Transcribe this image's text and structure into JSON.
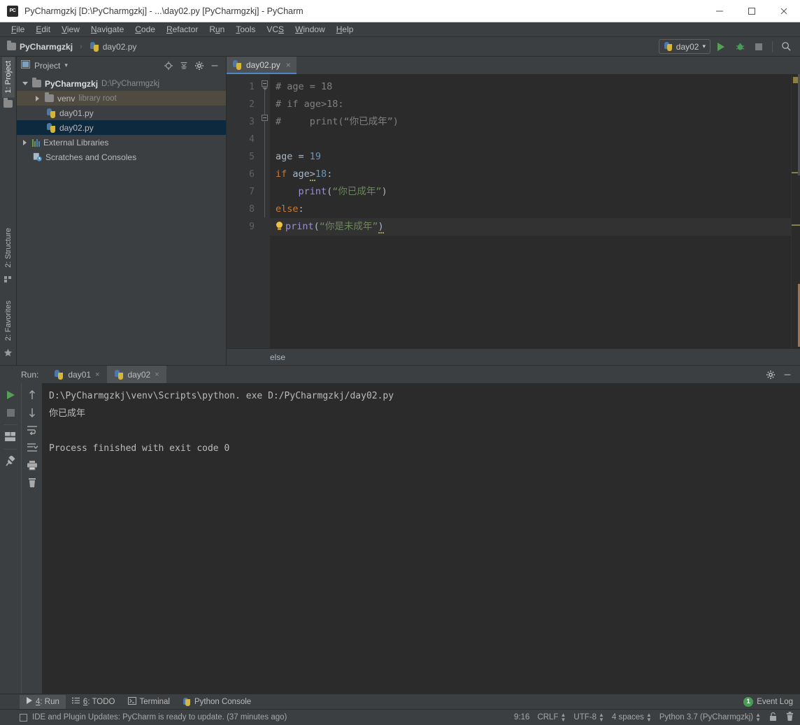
{
  "window": {
    "title": "PyCharmgzkj [D:\\PyCharmgzkj] - ...\\day02.py [PyCharmgzkj] - PyCharm",
    "app_badge": "PC",
    "minimize": "minimize-button",
    "maximize": "maximize-button",
    "close": "close-button"
  },
  "menubar": [
    {
      "label": "File",
      "mnemonic": "F"
    },
    {
      "label": "Edit",
      "mnemonic": "E"
    },
    {
      "label": "View",
      "mnemonic": "V"
    },
    {
      "label": "Navigate",
      "mnemonic": "N"
    },
    {
      "label": "Code",
      "mnemonic": "C"
    },
    {
      "label": "Refactor",
      "mnemonic": "R"
    },
    {
      "label": "Run",
      "mnemonic": "u"
    },
    {
      "label": "Tools",
      "mnemonic": "T"
    },
    {
      "label": "VCS",
      "mnemonic": "S"
    },
    {
      "label": "Window",
      "mnemonic": "W"
    },
    {
      "label": "Help",
      "mnemonic": "H"
    }
  ],
  "navbar": {
    "breadcrumb": [
      {
        "label": "PyCharmgzkj",
        "icon": "folder-icon"
      },
      {
        "label": "day02.py",
        "icon": "python-file-icon"
      }
    ],
    "separator": "›",
    "run_config": "day02",
    "run_config_caret": "▾",
    "buttons": [
      "run-button",
      "debug-button",
      "stop-button",
      "search-everywhere-button"
    ]
  },
  "left_strip": {
    "project_tab": "1: Project",
    "project_mnemonic": "1",
    "structure_tab": "2: Structure",
    "structure_mnemonic": "7",
    "favorites_tab": "2: Favorites",
    "favorites_mnemonic": "2"
  },
  "project_panel": {
    "title": "Project",
    "caret": "▾",
    "toolbar_icons": [
      "locate-icon",
      "collapse-all-icon",
      "settings-gear-icon",
      "hide-panel-icon"
    ],
    "tree": [
      {
        "label": "PyCharmgzkj",
        "suffix": "D:\\PyCharmgzkj",
        "depth": 0,
        "expanded": true,
        "icon": "folder-icon",
        "state": "normal",
        "bold": true
      },
      {
        "label": "venv",
        "suffix": "library root",
        "depth": 1,
        "expanded": false,
        "icon": "folder-icon",
        "state": "venv-highlight",
        "bold": false
      },
      {
        "label": "day01.py",
        "suffix": "",
        "depth": 2,
        "expanded": null,
        "icon": "python-file-icon",
        "state": "normal",
        "bold": false
      },
      {
        "label": "day02.py",
        "suffix": "",
        "depth": 2,
        "expanded": null,
        "icon": "python-file-icon",
        "state": "selected",
        "bold": false
      },
      {
        "label": "External Libraries",
        "suffix": "",
        "depth": 0,
        "expanded": false,
        "icon": "library-icon",
        "state": "normal",
        "bold": false
      },
      {
        "label": "Scratches and Consoles",
        "suffix": "",
        "depth": 0,
        "expanded": null,
        "icon": "scratches-icon",
        "state": "normal",
        "bold": false
      }
    ]
  },
  "editor": {
    "tab": {
      "label": "day02.py",
      "icon": "python-file-icon",
      "close": "×"
    },
    "line_numbers": [
      "1",
      "2",
      "3",
      "4",
      "5",
      "6",
      "7",
      "8",
      "9"
    ],
    "breadcrumb": "else",
    "lines": [
      {
        "n": 1,
        "tokens": [
          {
            "t": "# age = 18",
            "c": "c-comment"
          }
        ]
      },
      {
        "n": 2,
        "tokens": [
          {
            "t": "# if age>18:",
            "c": "c-comment"
          }
        ]
      },
      {
        "n": 3,
        "tokens": [
          {
            "t": "#     print(“你已成年”)",
            "c": "c-comment"
          }
        ]
      },
      {
        "n": 4,
        "tokens": []
      },
      {
        "n": 5,
        "tokens": [
          {
            "t": "age = ",
            "c": "c-def"
          },
          {
            "t": "19",
            "c": "c-num"
          }
        ]
      },
      {
        "n": 6,
        "tokens": [
          {
            "t": "if",
            "c": "c-kw"
          },
          {
            "t": " age",
            "c": "c-def"
          },
          {
            "t": ">",
            "c": "c-def wavy"
          },
          {
            "t": "18",
            "c": "c-num"
          },
          {
            "t": ":",
            "c": "c-def"
          }
        ]
      },
      {
        "n": 7,
        "tokens": [
          {
            "t": "    ",
            "c": "c-def"
          },
          {
            "t": "print",
            "c": "c-fn"
          },
          {
            "t": "(",
            "c": "c-paren"
          },
          {
            "t": "“你已成年”",
            "c": "c-str"
          },
          {
            "t": ")",
            "c": "c-paren"
          }
        ]
      },
      {
        "n": 8,
        "tokens": [
          {
            "t": "else",
            "c": "c-kw"
          },
          {
            "t": ":",
            "c": "c-def"
          }
        ]
      },
      {
        "n": 9,
        "tokens": [
          {
            "t": "  ",
            "c": "c-def"
          },
          {
            "t": "print",
            "c": "c-fn"
          },
          {
            "t": "(",
            "c": "c-paren"
          },
          {
            "t": "“你是未成年”",
            "c": "c-str"
          },
          {
            "t": ")",
            "c": "c-paren wavy"
          }
        ]
      }
    ]
  },
  "run_panel": {
    "label": "Run:",
    "tabs": [
      {
        "label": "day01",
        "icon": "python-file-icon",
        "close": "×",
        "active": false
      },
      {
        "label": "day02",
        "icon": "python-file-icon",
        "close": "×",
        "active": true
      }
    ],
    "header_icons": [
      "settings-gear-icon",
      "hide-panel-icon"
    ],
    "toolbar_left": [
      "rerun-icon",
      "stop-icon",
      "layout-icon",
      "pin-icon"
    ],
    "toolbar_right": [
      "up-arrow-icon",
      "down-arrow-icon",
      "soft-wrap-icon",
      "scroll-to-end-icon",
      "print-icon",
      "trash-icon"
    ],
    "console": [
      "D:\\PyCharmgzkj\\venv\\Scripts\\python. exe D:/PyCharmgzkj/day02.py",
      "你已成年",
      "",
      "Process finished with exit code 0"
    ]
  },
  "tool_window_bar": {
    "tabs": [
      {
        "label": "4: Run",
        "mnemonic": "4",
        "icon": "run-icon",
        "active": true
      },
      {
        "label": "6: TODO",
        "mnemonic": "6",
        "icon": "todo-icon",
        "active": false
      },
      {
        "label": "Terminal",
        "mnemonic": "",
        "icon": "terminal-icon",
        "active": false
      },
      {
        "label": "Python Console",
        "mnemonic": "",
        "icon": "python-console-icon",
        "active": false
      }
    ],
    "event_log": {
      "label": "Event Log",
      "count": "1"
    }
  },
  "status_bar": {
    "message": "IDE and Plugin Updates: PyCharm is ready to update. (37 minutes ago)",
    "message_icon": "notification-icon",
    "caret_position": "9:16",
    "line_separator": "CRLF",
    "encoding": "UTF-8",
    "indent": "4 spaces",
    "interpreter": "Python 3.7 (PyCharmgzkj)",
    "icons": [
      "lock-icon",
      "trash-icon"
    ]
  },
  "colors": {
    "accent": "#4a88c7",
    "run_green": "#56a056",
    "badge_green": "#499c54",
    "selection": "#0d293e",
    "venv_highlight": "#4f4b41",
    "editor_bg": "#2b2b2b",
    "panel_bg": "#3c3f41"
  }
}
